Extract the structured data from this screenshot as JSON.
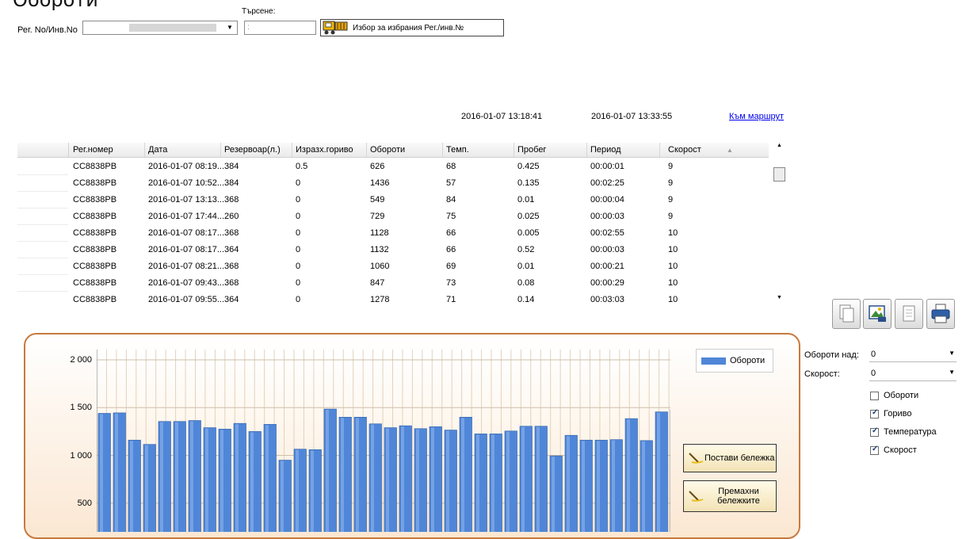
{
  "page_title": "Обороти",
  "filter": {
    "reg_label": "Рег. No/Инв.No",
    "search_label": "Търсене:",
    "pick_button_label": "Избор за избрания Рег./инв.№"
  },
  "info": {
    "start_time": "2016-01-07 13:18:41",
    "end_time": "2016-01-07 13:33:55",
    "route_link": "Към маршрут"
  },
  "table": {
    "columns": [
      "Рег.номер",
      "Дата",
      "Резервоар(л.)",
      "Изразх.гориво",
      "Обороти",
      "Темп.",
      "Пробег",
      "Период",
      "Скорост"
    ],
    "rows": [
      [
        "CC8838PB",
        "2016-01-07 08:19...",
        "384",
        "0.5",
        "626",
        "68",
        "0.425",
        "00:00:01",
        "9"
      ],
      [
        "CC8838PB",
        "2016-01-07 10:52...",
        "384",
        "0",
        "1436",
        "57",
        "0.135",
        "00:02:25",
        "9"
      ],
      [
        "CC8838PB",
        "2016-01-07 13:13...",
        "368",
        "0",
        "549",
        "84",
        "0.01",
        "00:00:04",
        "9"
      ],
      [
        "CC8838PB",
        "2016-01-07 17:44...",
        "260",
        "0",
        "729",
        "75",
        "0.025",
        "00:00:03",
        "9"
      ],
      [
        "CC8838PB",
        "2016-01-07 08:17...",
        "368",
        "0",
        "1128",
        "66",
        "0.005",
        "00:02:55",
        "10"
      ],
      [
        "CC8838PB",
        "2016-01-07 08:17...",
        "364",
        "0",
        "1132",
        "66",
        "0.52",
        "00:00:03",
        "10"
      ],
      [
        "CC8838PB",
        "2016-01-07 08:21...",
        "368",
        "0",
        "1060",
        "69",
        "0.01",
        "00:00:21",
        "10"
      ],
      [
        "CC8838PB",
        "2016-01-07 09:43...",
        "368",
        "0",
        "847",
        "73",
        "0.08",
        "00:00:29",
        "10"
      ],
      [
        "CC8838PB",
        "2016-01-07 09:55...",
        "364",
        "0",
        "1278",
        "71",
        "0.14",
        "00:03:03",
        "10"
      ]
    ]
  },
  "chart": {
    "legend": "Обороти",
    "bar_color": "#4f86d8",
    "y_ticks": [
      "2 000",
      "1 500",
      "1 000",
      "500"
    ],
    "values": [
      1440,
      1445,
      1160,
      1115,
      1355,
      1355,
      1365,
      1290,
      1275,
      1335,
      1250,
      1325,
      950,
      1065,
      1060,
      1485,
      1400,
      1400,
      1330,
      1290,
      1310,
      1280,
      1300,
      1265,
      1400,
      1225,
      1225,
      1255,
      1305,
      1305,
      995,
      1210,
      1160,
      1160,
      1165,
      1385,
      1155,
      1455,
      1480
    ]
  },
  "notes": {
    "add_label": "Постави бележка",
    "remove_label": "Премахни бележките"
  },
  "side": {
    "rpm_above_label": "Обороти над:",
    "rpm_above_value": "0",
    "speed_label": "Скорост:",
    "speed_value": "0",
    "checks": [
      {
        "label": "Обороти",
        "checked": false
      },
      {
        "label": "Гориво",
        "checked": true
      },
      {
        "label": "Температура",
        "checked": true
      },
      {
        "label": "Скорост",
        "checked": true
      }
    ]
  }
}
